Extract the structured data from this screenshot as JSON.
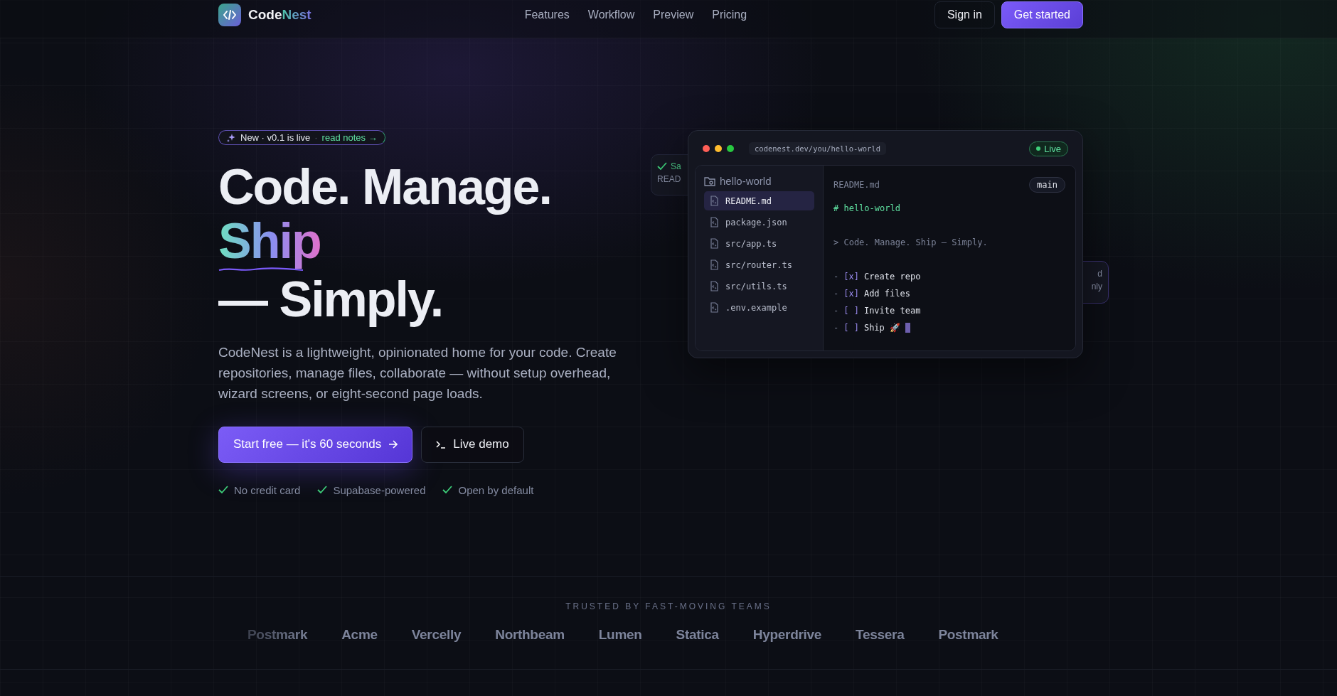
{
  "nav": {
    "brand": {
      "first": "Code",
      "second": "Nest"
    },
    "links": [
      {
        "label": "Features"
      },
      {
        "label": "Workflow"
      },
      {
        "label": "Preview"
      },
      {
        "label": "Pricing"
      }
    ],
    "sign_in": "Sign in",
    "get_started": "Get started"
  },
  "hero": {
    "badge": {
      "label": "New · v0.1 is live",
      "separator": "·",
      "link": "read notes →"
    },
    "heading": {
      "line_1": "Code. Manage.",
      "highlight": "Ship",
      "line_3": "— Simply."
    },
    "paragraph": "CodeNest is a lightweight, opinionated home for your code. Create repositories, manage files, collaborate — without setup overhead, wizard screens, or eight-second page loads.",
    "primary_button": "Start free — it's 60 seconds",
    "secondary_button": "Live demo",
    "checks": [
      {
        "label": "No credit card"
      },
      {
        "label": "Supabase-powered"
      },
      {
        "label": "Open by default"
      }
    ]
  },
  "preview": {
    "back_card_left": {
      "title": "Sa",
      "subtitle": "READ"
    },
    "back_card_right": {
      "line_1": "d",
      "line_2": "nly"
    },
    "url": "codenest.dev/you/hello-world",
    "status": "Live",
    "folder": "hello-world",
    "files": [
      {
        "name": "README.md",
        "selected": true
      },
      {
        "name": "package.json",
        "selected": false
      },
      {
        "name": "src/app.ts",
        "selected": false
      },
      {
        "name": "src/router.ts",
        "selected": false
      },
      {
        "name": "src/utils.ts",
        "selected": false
      },
      {
        "name": ".env.example",
        "selected": false
      }
    ],
    "filename": "README.md",
    "branch": "main",
    "lines": [
      {
        "kind": "heading",
        "text": "# hello-world"
      },
      {
        "kind": "blank"
      },
      {
        "kind": "quote",
        "text": "> Code. Manage. Ship — Simply."
      },
      {
        "kind": "blank"
      },
      {
        "kind": "task",
        "bullet": "-",
        "box": "[x]",
        "text": "Create repo",
        "cursor": false
      },
      {
        "kind": "task",
        "bullet": "-",
        "box": "[x]",
        "text": "Add files",
        "cursor": false
      },
      {
        "kind": "task",
        "bullet": "-",
        "box": "[ ]",
        "text": "Invite team",
        "cursor": false
      },
      {
        "kind": "task",
        "bullet": "-",
        "box": "[ ]",
        "text": "Ship 🚀",
        "cursor": true
      }
    ]
  },
  "trusted": {
    "label": "TRUSTED BY FAST-MOVING TEAMS",
    "logos": [
      {
        "name": "Postmark"
      },
      {
        "name": "Acme"
      },
      {
        "name": "Vercelly"
      },
      {
        "name": "Northbeam"
      },
      {
        "name": "Lumen"
      },
      {
        "name": "Statica"
      },
      {
        "name": "Hyperdrive"
      },
      {
        "name": "Tessera"
      },
      {
        "name": "Postmark"
      }
    ]
  }
}
